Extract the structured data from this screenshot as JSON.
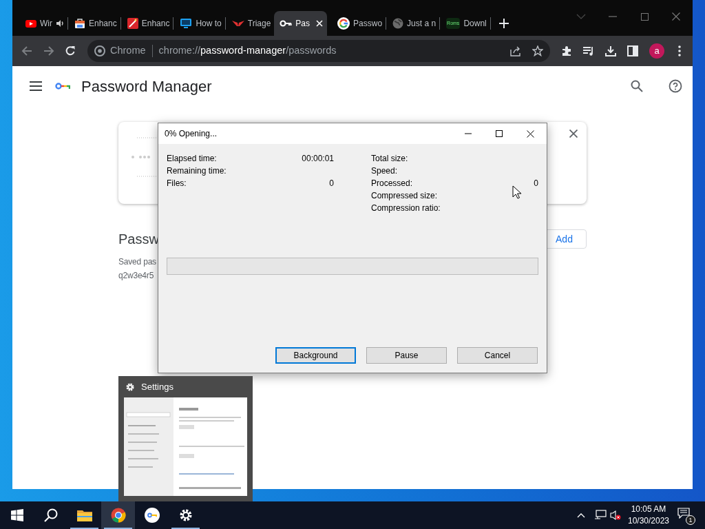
{
  "browser": {
    "tabs": [
      {
        "kind": "video",
        "title": "Wir",
        "audio": true,
        "selected": false
      },
      {
        "kind": "bag",
        "title": "Enhanc",
        "audio": false,
        "selected": false
      },
      {
        "kind": "wand",
        "title": "Enhanc",
        "audio": false,
        "selected": false
      },
      {
        "kind": "monitor",
        "title": "How to",
        "audio": false,
        "selected": false
      },
      {
        "kind": "bird",
        "title": "Triage",
        "audio": false,
        "selected": false
      },
      {
        "kind": "key",
        "title": "Pas",
        "audio": false,
        "selected": true
      },
      {
        "kind": "letter-g",
        "title": "Passwo",
        "audio": false,
        "selected": false
      },
      {
        "kind": "globe",
        "title": "Just a n",
        "audio": false,
        "selected": false
      },
      {
        "kind": "badge",
        "badge": "Roms",
        "title": "Downl",
        "audio": false,
        "selected": false
      }
    ],
    "omnibox": {
      "site": "Chrome",
      "url_scheme": "chrome://",
      "url_host": "password-manager",
      "url_path": "/passwords"
    },
    "avatar": "a"
  },
  "page": {
    "title": "Password Manager",
    "section_title": "Passw",
    "add_button": "Add",
    "saved_text": "Saved pas",
    "password_text": "q2w3e4r5"
  },
  "dialog": {
    "title": "0% Opening...",
    "stats_left": [
      {
        "label": "Elapsed time:",
        "value": "00:00:01"
      },
      {
        "label": "Remaining time:"
      },
      {
        "label": "Files:",
        "value": "0"
      }
    ],
    "stats_right": [
      {
        "label": "Total size:"
      },
      {
        "label": "Speed:"
      },
      {
        "label": "Processed:",
        "value": "0"
      },
      {
        "label": "Compressed size:"
      },
      {
        "label": "Compression ratio:"
      }
    ],
    "progress": {
      "level": 0
    },
    "buttons": [
      {
        "label": "Background",
        "focused": true
      },
      {
        "label": "Pause",
        "focused": false
      },
      {
        "label": "Cancel",
        "focused": false
      }
    ]
  },
  "thumbnail_popup": {
    "title": "Settings"
  },
  "taskbar": {
    "apps": [
      {
        "kind": "start",
        "running": false,
        "selected": false
      },
      {
        "kind": "search",
        "running": false,
        "selected": false
      },
      {
        "kind": "folder",
        "running": true,
        "selected": false
      },
      {
        "kind": "chrome",
        "running": true,
        "selected": true
      },
      {
        "kind": "key-app",
        "running": false,
        "selected": false
      },
      {
        "kind": "settings",
        "running": true,
        "selected": false
      }
    ],
    "clock": {
      "time": "10:05 AM",
      "date": "10/30/2023"
    },
    "notification_count": "1"
  }
}
